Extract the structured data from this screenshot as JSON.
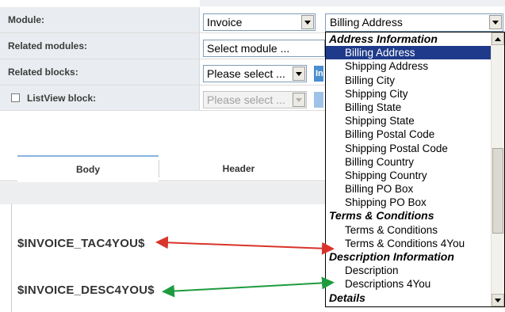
{
  "settings": {
    "module_label": "Module:",
    "module_value": "Invoice",
    "related_modules_label": "Related modules:",
    "related_modules_value": "Select module ...",
    "related_blocks_label": "Related blocks:",
    "related_blocks_value": "Please select ...",
    "related_blocks_button": "In",
    "listview_label": "ListView block:",
    "listview_value": "Please select ..."
  },
  "tabs": {
    "body": "Body",
    "header": "Header"
  },
  "variables": {
    "tac": "$INVOICE_TAC4YOU$",
    "desc": "$INVOICE_DESC4YOU$"
  },
  "dropdown": {
    "selected": "Billing Address",
    "items": [
      {
        "type": "group",
        "label": "Address Information"
      },
      {
        "type": "option",
        "label": "Billing Address",
        "selected": true
      },
      {
        "type": "option",
        "label": "Shipping Address"
      },
      {
        "type": "option",
        "label": "Billing City"
      },
      {
        "type": "option",
        "label": "Shipping City"
      },
      {
        "type": "option",
        "label": "Billing State"
      },
      {
        "type": "option",
        "label": "Shipping State"
      },
      {
        "type": "option",
        "label": "Billing Postal Code"
      },
      {
        "type": "option",
        "label": "Shipping Postal Code"
      },
      {
        "type": "option",
        "label": "Billing Country"
      },
      {
        "type": "option",
        "label": "Shipping Country"
      },
      {
        "type": "option",
        "label": "Billing PO Box"
      },
      {
        "type": "option",
        "label": "Shipping PO Box"
      },
      {
        "type": "group",
        "label": "Terms & Conditions"
      },
      {
        "type": "option",
        "label": "Terms & Conditions"
      },
      {
        "type": "option",
        "label": "Terms & Conditions 4You"
      },
      {
        "type": "group",
        "label": "Description Information"
      },
      {
        "type": "option",
        "label": "Description"
      },
      {
        "type": "option",
        "label": "Descriptions 4You"
      },
      {
        "type": "group",
        "label": "Details"
      }
    ]
  },
  "colors": {
    "selected_highlight": "#1f3a8a",
    "arrow_red": "#d9342b",
    "arrow_green": "#1e9b3e",
    "button_blue": "#4a8ed0"
  }
}
